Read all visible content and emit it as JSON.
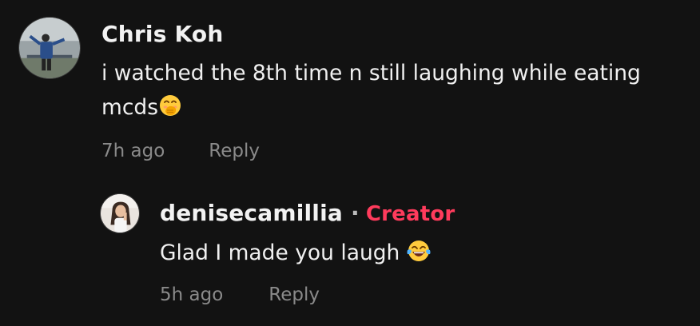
{
  "comment": {
    "author": "Chris Koh",
    "text_line1": "i watched the 8th time n still laughing while eating",
    "text_line2": "mcds",
    "emoji_icon": "hand-over-mouth-emoji",
    "time": "7h ago",
    "reply_label": "Reply"
  },
  "reply": {
    "author": "denisecamillia",
    "separator": "·",
    "badge": "Creator",
    "badge_color": "#ff3b5c",
    "text": "Glad I made you laugh",
    "emoji_icon": "tears-of-joy-emoji",
    "time": "5h ago",
    "reply_label": "Reply"
  },
  "colors": {
    "background": "#121212",
    "text": "#f0f0f0",
    "meta": "#8a8a8a"
  }
}
